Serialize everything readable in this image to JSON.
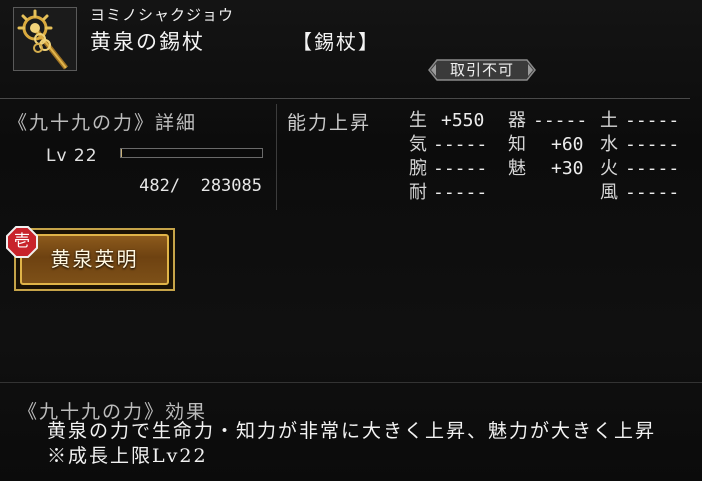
{
  "item": {
    "reading": "ヨミノシャクジョウ",
    "name": "黄泉の錫杖",
    "type": "【錫杖】",
    "trade_badge": "取引不可",
    "icon": "golden-staff-icon"
  },
  "power": {
    "detail_title": "《九十九の力》詳細",
    "level_label": "Lv 22",
    "exp_text": "482/  283085",
    "exp_progress": 0.0017
  },
  "stats": {
    "label": "能力上昇",
    "rows": [
      [
        {
          "name": "生",
          "value": "+550"
        },
        {
          "name": "器",
          "value": "-----"
        },
        {
          "name": "土",
          "value": "-----"
        }
      ],
      [
        {
          "name": "気",
          "value": "-----"
        },
        {
          "name": "知",
          "value": "+60"
        },
        {
          "name": "水",
          "value": "-----"
        }
      ],
      [
        {
          "name": "腕",
          "value": "-----"
        },
        {
          "name": "魅",
          "value": "+30"
        },
        {
          "name": "火",
          "value": "-----"
        }
      ],
      [
        {
          "name": "耐",
          "value": "-----"
        },
        null,
        {
          "name": "風",
          "value": "-----"
        }
      ]
    ]
  },
  "skill": {
    "mark": "壱",
    "name": "黄泉英明"
  },
  "effect": {
    "title": "《九十九の力》効果",
    "body": "黄泉の力で生命力・知力が非常に大きく上昇、魅力が大きく上昇 ※成長上限Lv22"
  },
  "colors": {
    "gold_border": "#c6a449",
    "skill_fill": "#7d5018",
    "mark_red": "#c8232b",
    "exp_fill": "#c9b27a"
  }
}
